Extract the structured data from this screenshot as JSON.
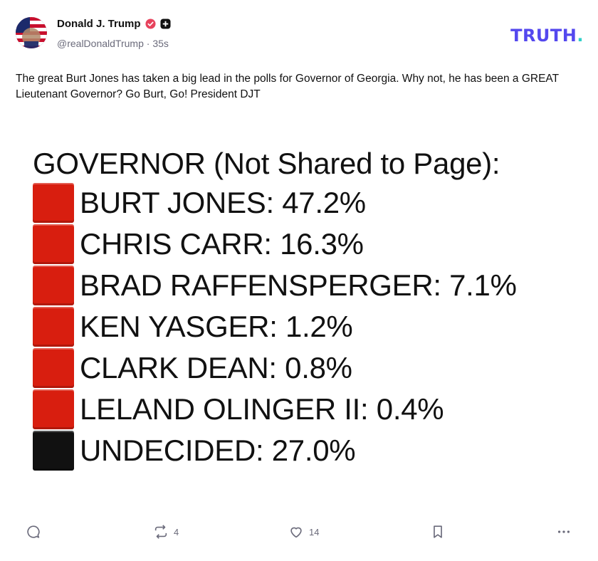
{
  "post": {
    "author_name": "Donald J. Trump",
    "handle": "@realDonaldTrump",
    "separator": "·",
    "time_ago": "35s",
    "text": "The great Burt Jones has taken a big lead in the polls for Governor of Georgia. Why not, he has been a GREAT Lieutenant Governor? Go Burt, Go! President DJT",
    "icons": {
      "avatar": "flag-avatar",
      "verified": "verified-badge-icon",
      "plus": "plus-badge-icon"
    }
  },
  "brand": {
    "logo_main": "TRUTH",
    "logo_dot": ".",
    "color": "#5448ee",
    "dot_color": "#2fd0c8"
  },
  "poll": {
    "title": "GOVERNOR (Not Shared to Page):",
    "rows": [
      {
        "label": "BURT JONES: 47.2%",
        "color": "#d81e0f"
      },
      {
        "label": "CHRIS CARR: 16.3%",
        "color": "#d81e0f"
      },
      {
        "label": "BRAD RAFFENSPERGER: 7.1%",
        "color": "#d81e0f"
      },
      {
        "label": "KEN YASGER: 1.2%",
        "color": "#d81e0f"
      },
      {
        "label": "CLARK DEAN: 0.8%",
        "color": "#d81e0f"
      },
      {
        "label": "LELAND OLINGER II: 0.4%",
        "color": "#d81e0f"
      },
      {
        "label": "UNDECIDED: 27.0%",
        "color": "#111111"
      }
    ]
  },
  "actions": {
    "reply": {
      "icon": "reply-icon"
    },
    "retruth": {
      "icon": "retruth-icon",
      "count": "4"
    },
    "like": {
      "icon": "heart-icon",
      "count": "14"
    },
    "bookmark": {
      "icon": "bookmark-icon"
    },
    "more": {
      "icon": "more-icon"
    }
  }
}
